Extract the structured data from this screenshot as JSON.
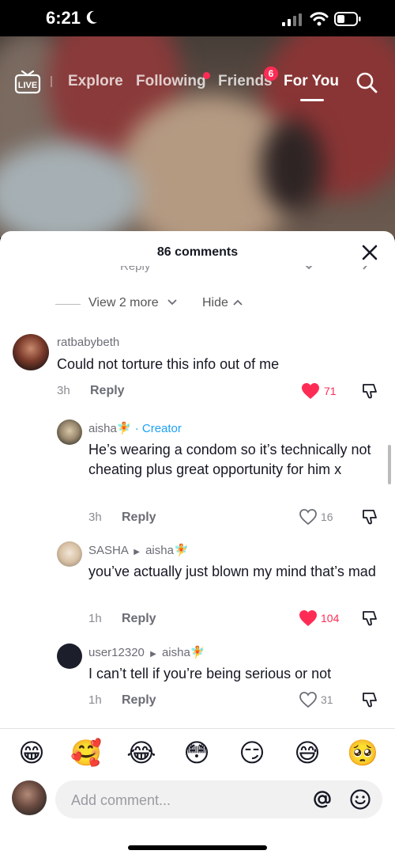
{
  "status_bar": {
    "time": "6:21",
    "icons": [
      "moon-icon",
      "signal-icon",
      "wifi-icon",
      "battery-icon"
    ]
  },
  "top_nav": {
    "live_label": "LIVE",
    "tabs": [
      {
        "label": "Explore",
        "active": false
      },
      {
        "label": "Following",
        "active": false,
        "dot": true
      },
      {
        "label": "Friends",
        "active": false,
        "badge": "6"
      },
      {
        "label": "For You",
        "active": true
      }
    ]
  },
  "sheet": {
    "title": "86 comments",
    "clipped_reply": "Reply",
    "view_more": "View 2 more",
    "hide": "Hide",
    "comments": [
      {
        "username": "ratbabybeth",
        "text": "Could not torture this info out of me",
        "time": "3h",
        "reply_label": "Reply",
        "likes": "71",
        "liked": true
      },
      {
        "username": "aisha🧚",
        "creator_label": "· Creator",
        "text": "He’s wearing a condom so it’s technically not cheating plus great opportunity for him x",
        "time": "3h",
        "reply_label": "Reply",
        "likes": "16",
        "liked": false
      },
      {
        "username": "SASHA",
        "reply_to": "aisha🧚",
        "text": "you’ve actually just blown my mind that’s mad",
        "time": "1h",
        "reply_label": "Reply",
        "likes": "104",
        "liked": true
      },
      {
        "username": "user12320",
        "reply_to": "aisha🧚",
        "text": "I can’t tell if you’re being serious or not",
        "time": "1h",
        "reply_label": "Reply",
        "likes": "31",
        "liked": false
      }
    ]
  },
  "emoji_bar": [
    "😁",
    "🥰",
    "😂",
    "😳",
    "😏",
    "😅",
    "🥺"
  ],
  "composer": {
    "placeholder": "Add comment..."
  },
  "colors": {
    "accent_red": "#fe2c55",
    "creator_blue": "#1da1f2",
    "text_primary": "#161823",
    "text_secondary": "#8a8b91"
  }
}
